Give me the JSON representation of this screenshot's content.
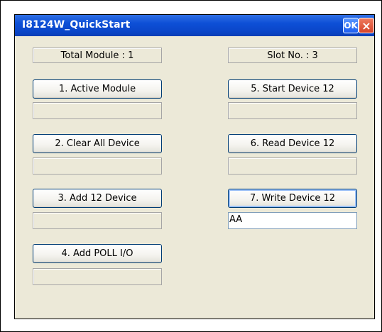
{
  "window": {
    "title": "I8124W_QuickStart",
    "ok_label": "OK",
    "close_label": "×"
  },
  "labels": {
    "total_module": "Total Module : 1",
    "slot_no": "Slot No. : 3"
  },
  "buttons": {
    "active_module": "1. Active Module",
    "clear_all_device": "2. Clear All Device",
    "add_12_device": "3. Add 12 Device",
    "add_poll_io": "4. Add POLL I/O",
    "start_device_12": "5. Start Device 12",
    "read_device_12": "6. Read Device 12",
    "write_device_12": "7. Write Device 12"
  },
  "inputs": {
    "write_value": "AA"
  }
}
